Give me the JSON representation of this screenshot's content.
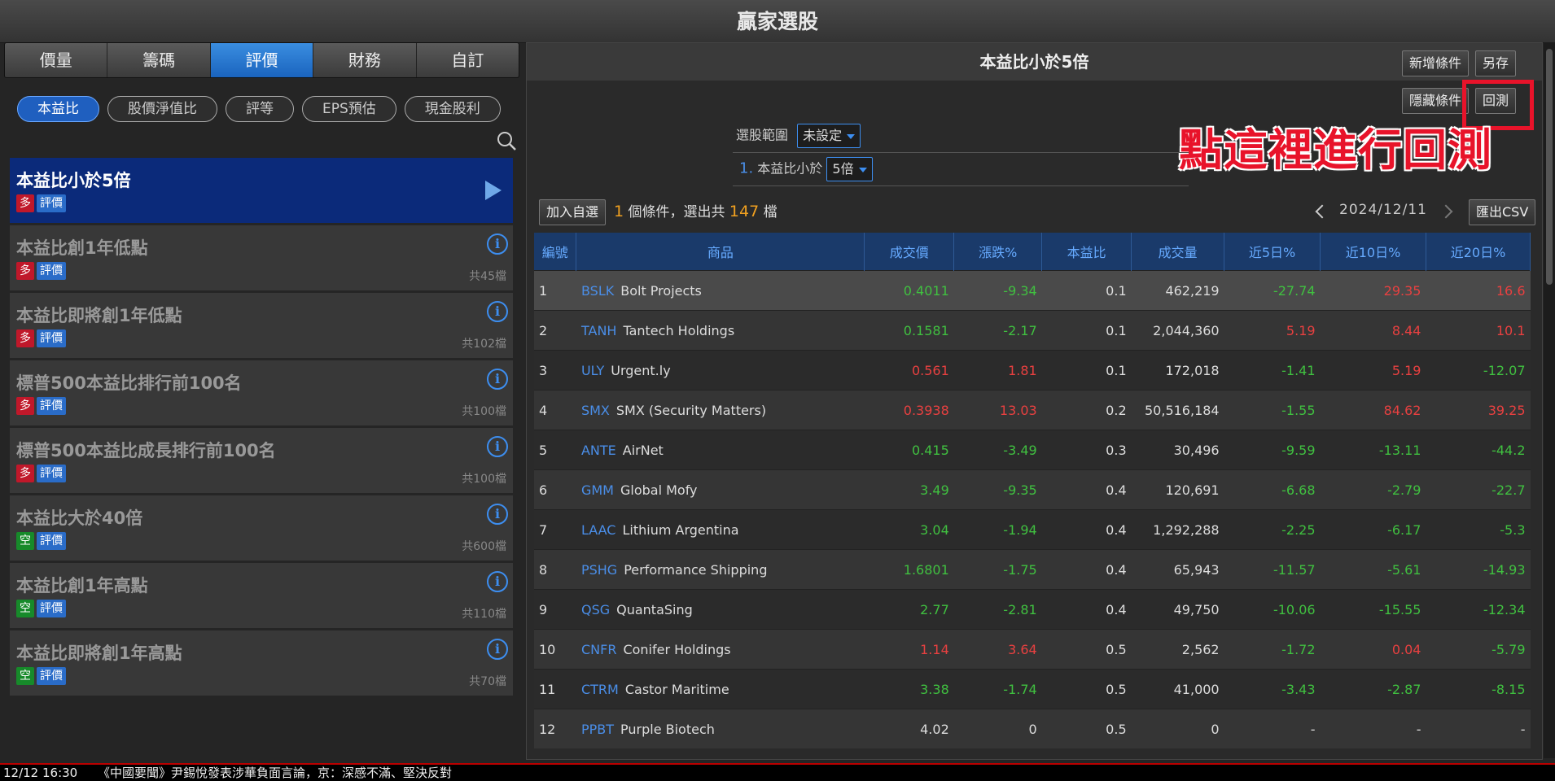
{
  "app_title": "贏家選股",
  "tabs": [
    {
      "label": "價量"
    },
    {
      "label": "籌碼"
    },
    {
      "label": "評價"
    },
    {
      "label": "財務"
    },
    {
      "label": "自訂"
    }
  ],
  "sub_tabs": [
    {
      "label": "本益比"
    },
    {
      "label": "股價淨值比"
    },
    {
      "label": "評等"
    },
    {
      "label": "EPS預估"
    },
    {
      "label": "現金股利"
    }
  ],
  "strategies": [
    {
      "title": "本益比小於5倍",
      "tag1": "多",
      "tag2": "評價",
      "count": ""
    },
    {
      "title": "本益比創1年低點",
      "tag1": "多",
      "tag2": "評價",
      "count": "共45檔"
    },
    {
      "title": "本益比即將創1年低點",
      "tag1": "多",
      "tag2": "評價",
      "count": "共102檔"
    },
    {
      "title": "標普500本益比排行前100名",
      "tag1": "多",
      "tag2": "評價",
      "count": "共100檔"
    },
    {
      "title": "標普500本益比成長排行前100名",
      "tag1": "多",
      "tag2": "評價",
      "count": "共100檔"
    },
    {
      "title": "本益比大於40倍",
      "tag1": "空",
      "tag2": "評價",
      "count": "共600檔"
    },
    {
      "title": "本益比創1年高點",
      "tag1": "空",
      "tag2": "評價",
      "count": "共110檔"
    },
    {
      "title": "本益比即將創1年高點",
      "tag1": "空",
      "tag2": "評價",
      "count": "共70檔"
    }
  ],
  "panel": {
    "title": "本益比小於5倍",
    "add_condition": "新增條件",
    "save_as": "另存",
    "hide_conditions": "隱藏條件",
    "backtest": "回測",
    "annotation": "點這裡進行回測",
    "scope_label": "選股範圍",
    "scope_value": "未設定",
    "cond_index": "1.",
    "cond_label": "本益比小於",
    "cond_value": "5倍",
    "add_watchlist": "加入自選",
    "summary_count": "1",
    "summary_mid": "個條件，選出共",
    "summary_total": "147",
    "summary_unit": "檔",
    "date": "2024/12/11",
    "export_csv": "匯出CSV"
  },
  "table": {
    "headers": [
      "編號",
      "商品",
      "成交價",
      "漲跌%",
      "本益比",
      "成交量",
      "近5日%",
      "近10日%",
      "近20日%"
    ],
    "rows": [
      {
        "idx": "1",
        "sym": "BSLK",
        "name": "Bolt Projects",
        "price": "0.4011",
        "chg": "-9.34",
        "pe": "0.1",
        "vol": "462,219",
        "d5": "-27.74",
        "d10": "29.35",
        "d20": "16.6",
        "pc": "down",
        "cc": "down",
        "c5": "down",
        "c10": "up",
        "c20": "up"
      },
      {
        "idx": "2",
        "sym": "TANH",
        "name": "Tantech Holdings",
        "price": "0.1581",
        "chg": "-2.17",
        "pe": "0.1",
        "vol": "2,044,360",
        "d5": "5.19",
        "d10": "8.44",
        "d20": "10.1",
        "pc": "down",
        "cc": "down",
        "c5": "up",
        "c10": "up",
        "c20": "up"
      },
      {
        "idx": "3",
        "sym": "ULY",
        "name": "Urgent.ly",
        "price": "0.561",
        "chg": "1.81",
        "pe": "0.1",
        "vol": "172,018",
        "d5": "-1.41",
        "d10": "5.19",
        "d20": "-12.07",
        "pc": "up",
        "cc": "up",
        "c5": "down",
        "c10": "up",
        "c20": "down"
      },
      {
        "idx": "4",
        "sym": "SMX",
        "name": "SMX (Security Matters)",
        "price": "0.3938",
        "chg": "13.03",
        "pe": "0.2",
        "vol": "50,516,184",
        "d5": "-1.55",
        "d10": "84.62",
        "d20": "39.25",
        "pc": "up",
        "cc": "up",
        "c5": "down",
        "c10": "up",
        "c20": "up"
      },
      {
        "idx": "5",
        "sym": "ANTE",
        "name": "AirNet",
        "price": "0.415",
        "chg": "-3.49",
        "pe": "0.3",
        "vol": "30,496",
        "d5": "-9.59",
        "d10": "-13.11",
        "d20": "-44.2",
        "pc": "down",
        "cc": "down",
        "c5": "down",
        "c10": "down",
        "c20": "down"
      },
      {
        "idx": "6",
        "sym": "GMM",
        "name": "Global Mofy",
        "price": "3.49",
        "chg": "-9.35",
        "pe": "0.4",
        "vol": "120,691",
        "d5": "-6.68",
        "d10": "-2.79",
        "d20": "-22.7",
        "pc": "down",
        "cc": "down",
        "c5": "down",
        "c10": "down",
        "c20": "down"
      },
      {
        "idx": "7",
        "sym": "LAAC",
        "name": "Lithium Argentina",
        "price": "3.04",
        "chg": "-1.94",
        "pe": "0.4",
        "vol": "1,292,288",
        "d5": "-2.25",
        "d10": "-6.17",
        "d20": "-5.3",
        "pc": "down",
        "cc": "down",
        "c5": "down",
        "c10": "down",
        "c20": "down"
      },
      {
        "idx": "8",
        "sym": "PSHG",
        "name": "Performance Shipping",
        "price": "1.6801",
        "chg": "-1.75",
        "pe": "0.4",
        "vol": "65,943",
        "d5": "-11.57",
        "d10": "-5.61",
        "d20": "-14.93",
        "pc": "down",
        "cc": "down",
        "c5": "down",
        "c10": "down",
        "c20": "down"
      },
      {
        "idx": "9",
        "sym": "QSG",
        "name": "QuantaSing",
        "price": "2.77",
        "chg": "-2.81",
        "pe": "0.4",
        "vol": "49,750",
        "d5": "-10.06",
        "d10": "-15.55",
        "d20": "-12.34",
        "pc": "down",
        "cc": "down",
        "c5": "down",
        "c10": "down",
        "c20": "down"
      },
      {
        "idx": "10",
        "sym": "CNFR",
        "name": "Conifer Holdings",
        "price": "1.14",
        "chg": "3.64",
        "pe": "0.5",
        "vol": "2,562",
        "d5": "-1.72",
        "d10": "0.04",
        "d20": "-5.79",
        "pc": "up",
        "cc": "up",
        "c5": "down",
        "c10": "up",
        "c20": "down"
      },
      {
        "idx": "11",
        "sym": "CTRM",
        "name": "Castor Maritime",
        "price": "3.38",
        "chg": "-1.74",
        "pe": "0.5",
        "vol": "41,000",
        "d5": "-3.43",
        "d10": "-2.87",
        "d20": "-8.15",
        "pc": "down",
        "cc": "down",
        "c5": "down",
        "c10": "down",
        "c20": "down"
      },
      {
        "idx": "12",
        "sym": "PPBT",
        "name": "Purple Biotech",
        "price": "4.02",
        "chg": "0",
        "pe": "0.5",
        "vol": "0",
        "d5": "-",
        "d10": "-",
        "d20": "-",
        "pc": "flat",
        "cc": "flat",
        "c5": "flat",
        "c10": "flat",
        "c20": "flat"
      }
    ]
  },
  "ticker": {
    "time": "12/12 16:30",
    "text": "《中國要聞》尹錫悅發表涉華負面言論，京：深感不滿、堅決反對"
  }
}
